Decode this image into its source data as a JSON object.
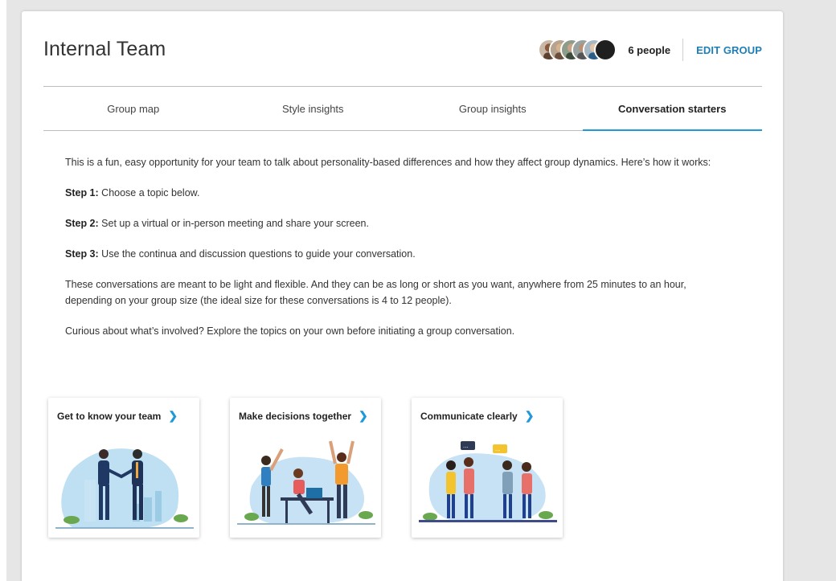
{
  "header": {
    "title": "Internal Team",
    "people_count": "6 people",
    "edit_label": "EDIT GROUP"
  },
  "tabs": [
    {
      "label": "Group map"
    },
    {
      "label": "Style insights"
    },
    {
      "label": "Group insights"
    },
    {
      "label": "Conversation starters",
      "active": true
    }
  ],
  "content": {
    "intro": "This is a fun, easy opportunity for your team to talk about personality-based differences and how they affect group dynamics. Here’s how it works:",
    "step1_label": "Step 1:",
    "step1_text": " Choose a topic below.",
    "step2_label": "Step 2:",
    "step2_text": " Set up a virtual or in-person meeting and share your screen.",
    "step3_label": "Step 3:",
    "step3_text": " Use the continua and discussion questions to guide your conversation.",
    "note": "These conversations are meant to be light and flexible. And they can be as long or short as you want, anywhere from 25 minutes to an hour, depending on your group size (the ideal size for these conversations is 4 to 12 people).",
    "explore": "Curious about what’s involved? Explore the topics on your own before initiating a group conversation."
  },
  "topics": [
    {
      "title": "Get to know your team",
      "icon": "chevron-right-icon"
    },
    {
      "title": "Make decisions together",
      "icon": "chevron-right-icon"
    },
    {
      "title": "Communicate clearly",
      "icon": "chevron-right-icon"
    }
  ],
  "colors": {
    "accent": "#1e7fb8",
    "tab_underline": "#1e9ad6",
    "background": "#e6e6e6"
  }
}
